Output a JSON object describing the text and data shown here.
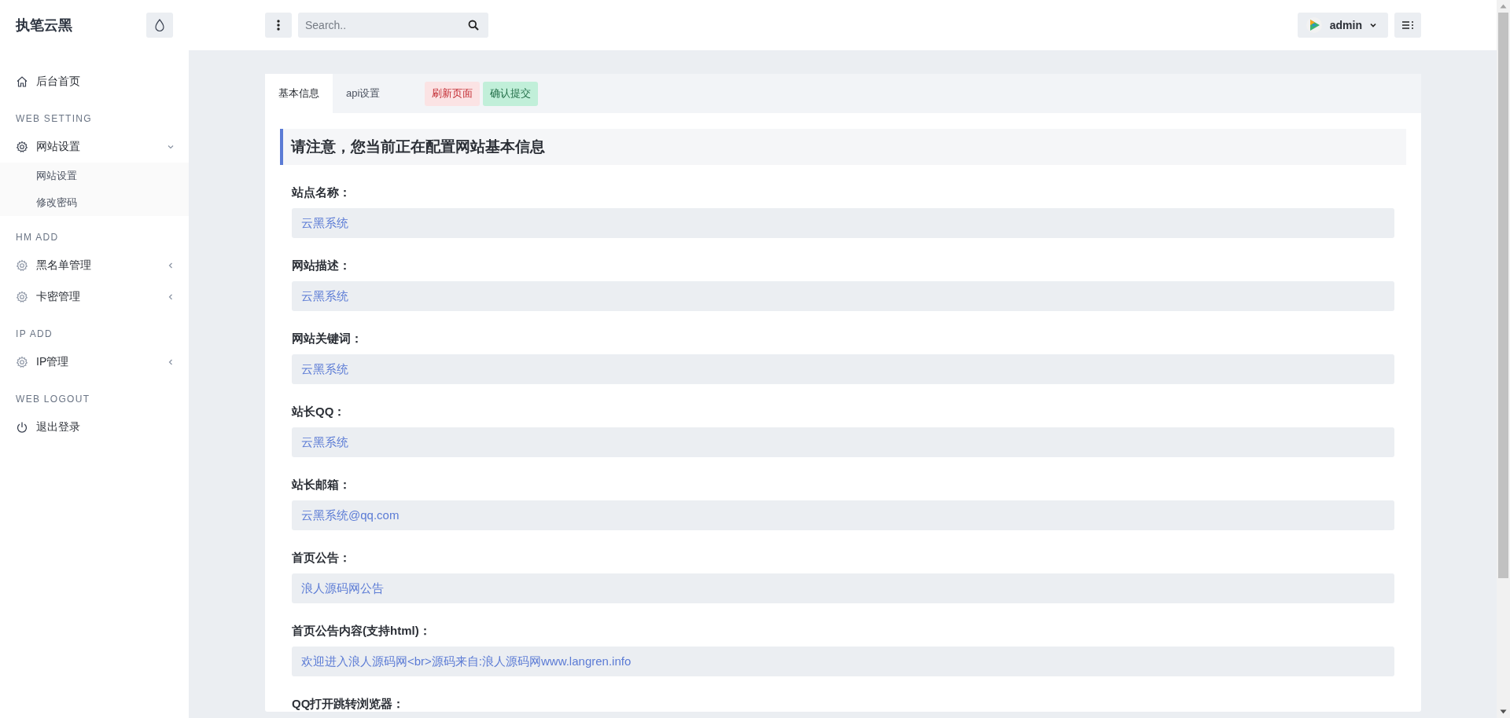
{
  "brand": {
    "title": "执笔云黑"
  },
  "header": {
    "search": {
      "placeholder": "Search.."
    },
    "user": {
      "name": "admin"
    }
  },
  "sidebar": {
    "sections": [
      {
        "items": [
          {
            "label": "后台首页",
            "kind": "home"
          }
        ]
      },
      {
        "heading": "WEB SETTING",
        "items": [
          {
            "label": "网站设置",
            "kind": "menu",
            "expanded": true,
            "children": [
              {
                "label": "网站设置"
              },
              {
                "label": "修改密码"
              }
            ]
          }
        ]
      },
      {
        "heading": "HM ADD",
        "items": [
          {
            "label": "黑名单管理",
            "kind": "menu",
            "expanded": false
          },
          {
            "label": "卡密管理",
            "kind": "menu",
            "expanded": false
          }
        ]
      },
      {
        "heading": "IP ADD",
        "items": [
          {
            "label": "IP管理",
            "kind": "menu",
            "expanded": false
          }
        ]
      },
      {
        "heading": "WEB LOGOUT",
        "items": [
          {
            "label": "退出登录",
            "kind": "logout"
          }
        ]
      }
    ]
  },
  "tabs": [
    {
      "label": "基本信息",
      "selected": true
    },
    {
      "label": "api设置",
      "selected": false
    }
  ],
  "actions": [
    {
      "label": "刷新页面",
      "kind": "danger"
    },
    {
      "label": "确认提交",
      "kind": "success"
    }
  ],
  "notice": "请注意，您当前正在配置网站基本信息",
  "fields": [
    {
      "label": "站点名称：",
      "value": "云黑系统"
    },
    {
      "label": "网站描述：",
      "value": "云黑系统"
    },
    {
      "label": "网站关键词：",
      "value": "云黑系统"
    },
    {
      "label": "站长QQ：",
      "value": "云黑系统"
    },
    {
      "label": "站长邮箱：",
      "value": "云黑系统@qq.com"
    },
    {
      "label": "首页公告：",
      "value": "浪人源码网公告"
    },
    {
      "label": "首页公告内容(支持html)：",
      "value": "欢迎进入浪人源码网<br>源码来自:浪人源码网www.langren.info"
    },
    {
      "label": "QQ打开跳转浏览器："
    }
  ]
}
